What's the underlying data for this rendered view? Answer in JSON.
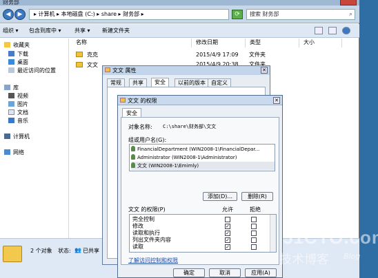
{
  "explorer": {
    "title": "财务部",
    "address": "▸ 计算机 ▸ 本地磁盘 (C:) ▸ share ▸ 财务部 ▸",
    "search_placeholder": "搜索 财务部",
    "toolbar": [
      "组织 ▾",
      "包含到库中 ▾",
      "共享 ▾",
      "新建文件夹"
    ],
    "columns": [
      "名称",
      "修改日期",
      "类型",
      "大小"
    ],
    "files": [
      {
        "name": "克克",
        "date": "2015/4/9 17:09",
        "type": "文件夹"
      },
      {
        "name": "文文",
        "date": "2015/4/9 20:38",
        "type": "文件夹"
      }
    ],
    "nav": {
      "favorites": "收藏夹",
      "downloads": "下载",
      "desktop": "桌面",
      "recent": "最近访问的位置",
      "libraries": "库",
      "videos": "视频",
      "pictures": "图片",
      "documents": "文档",
      "music": "音乐",
      "computer": "计算机",
      "network": "网络"
    },
    "status": {
      "count": "2 个对象",
      "state_label": "状态:",
      "state_value": "已共享"
    }
  },
  "props_dialog": {
    "title": "文文 属性",
    "tabs": [
      "常规",
      "共享",
      "安全",
      "以前的版本",
      "自定义"
    ]
  },
  "perm_dialog": {
    "title": "文文 的权限",
    "tab": "安全",
    "object_label": "对象名称:",
    "object_value": "C:\\share\\财务部\\文文",
    "group_label": "组或用户名(G):",
    "users": [
      "FinancialDepartment (WIN2008-1\\FinancialDepar...",
      "Administrator (WIN2008-1\\Administrator)",
      "文文 (WIN2008-1\\Emimly)"
    ],
    "add_btn": "添加(D)...",
    "remove_btn": "删除(R)",
    "perm_for_label": "文文 的权限(P)",
    "allow_label": "允许",
    "deny_label": "拒绝",
    "permissions": [
      {
        "name": "完全控制",
        "allow": false,
        "deny": false
      },
      {
        "name": "修改",
        "allow": true,
        "deny": false
      },
      {
        "name": "读取和执行",
        "allow": true,
        "deny": false
      },
      {
        "name": "列出文件夹内容",
        "allow": true,
        "deny": false
      },
      {
        "name": "读取",
        "allow": true,
        "deny": false
      }
    ],
    "link": "了解访问控制和权限",
    "ok": "确定",
    "cancel": "取消",
    "apply": "应用(A)"
  },
  "watermark": {
    "site": "51CTO.com",
    "sub": "技术博客",
    "blog": "Blog"
  }
}
